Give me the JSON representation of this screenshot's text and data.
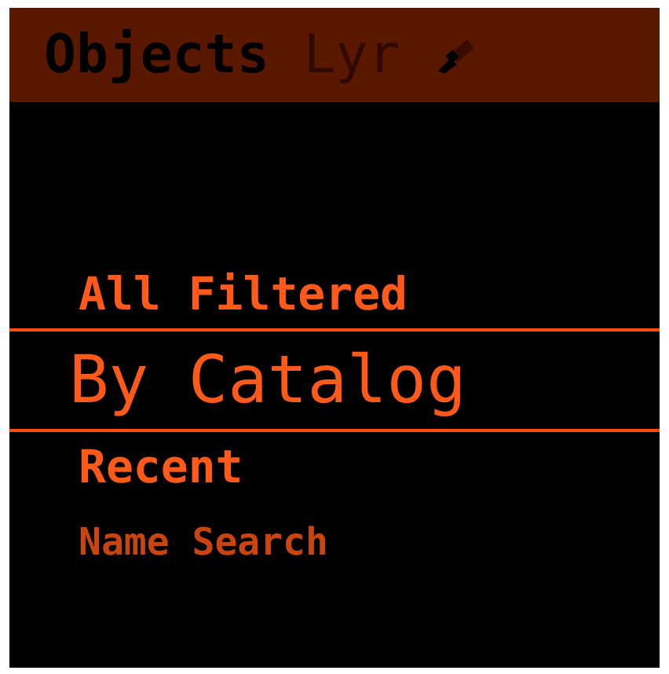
{
  "tabs": [
    {
      "label": "Objects",
      "selected": true
    },
    {
      "label": "Lyr",
      "selected": false
    }
  ],
  "menu": [
    {
      "label": "All Filtered",
      "selected": false
    },
    {
      "label": "By Catalog",
      "selected": true
    },
    {
      "label": "Recent",
      "selected": false
    },
    {
      "label": "Name Search",
      "selected": false
    }
  ]
}
